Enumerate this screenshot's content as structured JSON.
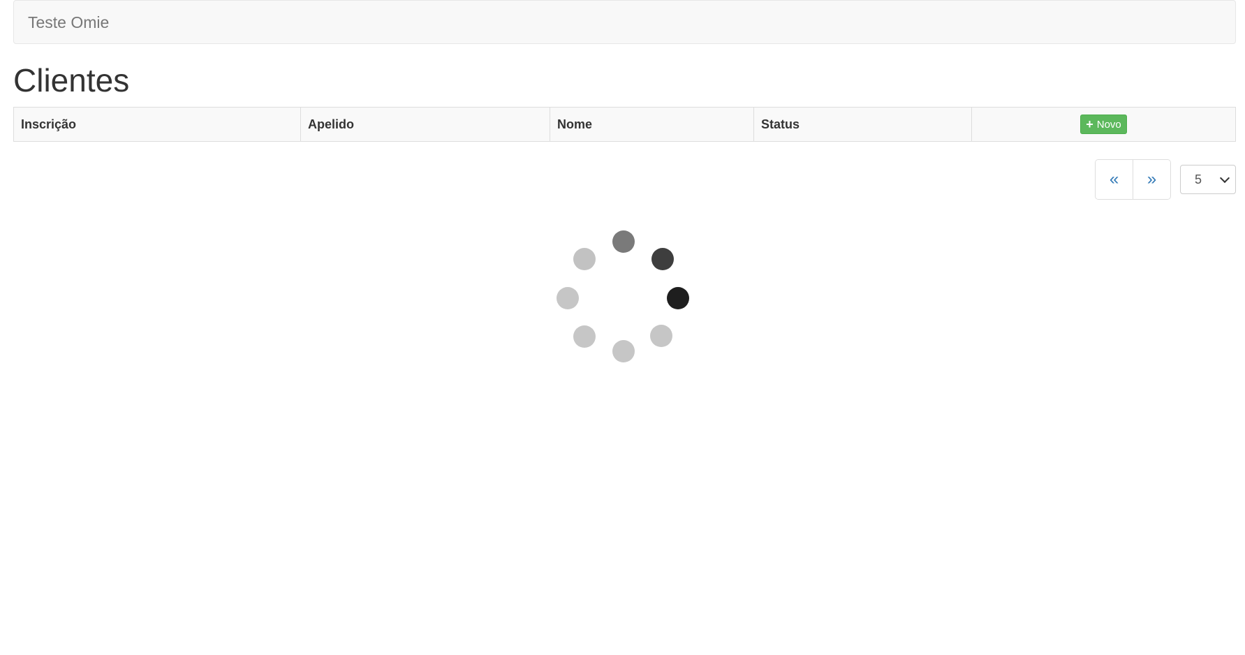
{
  "navbar": {
    "brand": "Teste Omie"
  },
  "page": {
    "title": "Clientes"
  },
  "table": {
    "columns": [
      "Inscrição",
      "Apelido",
      "Nome",
      "Status"
    ],
    "new_button_label": "Novo",
    "new_button_icon": "plus-icon",
    "new_button_color": "#5cb85c"
  },
  "pagination": {
    "prev_label": "«",
    "next_label": "»",
    "page_size": "5",
    "link_color": "#337ab7"
  },
  "loading": {
    "spinner_dots": 8,
    "dot_shades": [
      "#7a7a7a",
      "#3e3e3e",
      "#1e1e1e",
      "#c6c6c6",
      "#c6c6c6",
      "#c6c6c6",
      "#c6c6c6",
      "#c2c2c2"
    ]
  }
}
